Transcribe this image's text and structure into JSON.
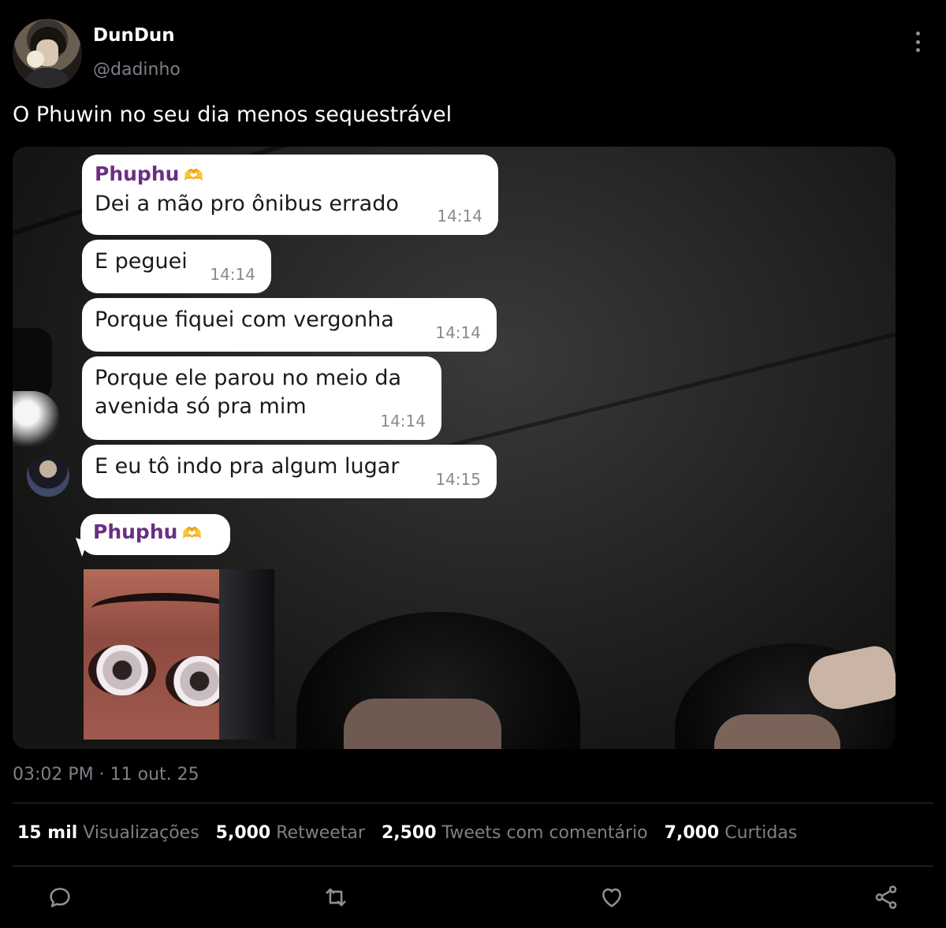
{
  "tweet": {
    "author_name": "DunDun",
    "author_handle": "@dadinho",
    "text": "O Phuwin no seu dia menos sequestrável",
    "time": "03:02 PM",
    "separator": "·",
    "date": "11 out. 25"
  },
  "chat": {
    "sender": "Phuphu",
    "sender_emoji": "🫶",
    "messages": [
      {
        "text": "Dei a mão pro ônibus errado",
        "time": "14:14"
      },
      {
        "text": "E peguei",
        "time": "14:14"
      },
      {
        "text": "Porque fiquei com vergonha",
        "time": "14:14"
      },
      {
        "text": "Porque ele parou no meio da\navenida só pra mim",
        "time": "14:14"
      },
      {
        "text": "E eu tô indo pra algum lugar",
        "time": "14:15"
      }
    ],
    "second_sender": "Phuphu"
  },
  "stats": [
    {
      "count": "15 mil",
      "label": "Visualizações"
    },
    {
      "count": "5,000",
      "label": "Retweetar"
    },
    {
      "count": "2,500",
      "label": "Tweets com comentário"
    },
    {
      "count": "7,000",
      "label": "Curtidas"
    }
  ],
  "icons": {
    "more": "more-vertical-icon",
    "reply": "reply-icon",
    "retweet": "retweet-icon",
    "like": "heart-icon",
    "share": "share-icon"
  },
  "colors": {
    "background": "#000000",
    "text": "#e7e9ea",
    "muted": "#7b8187",
    "sender_name": "#6a2f82"
  }
}
